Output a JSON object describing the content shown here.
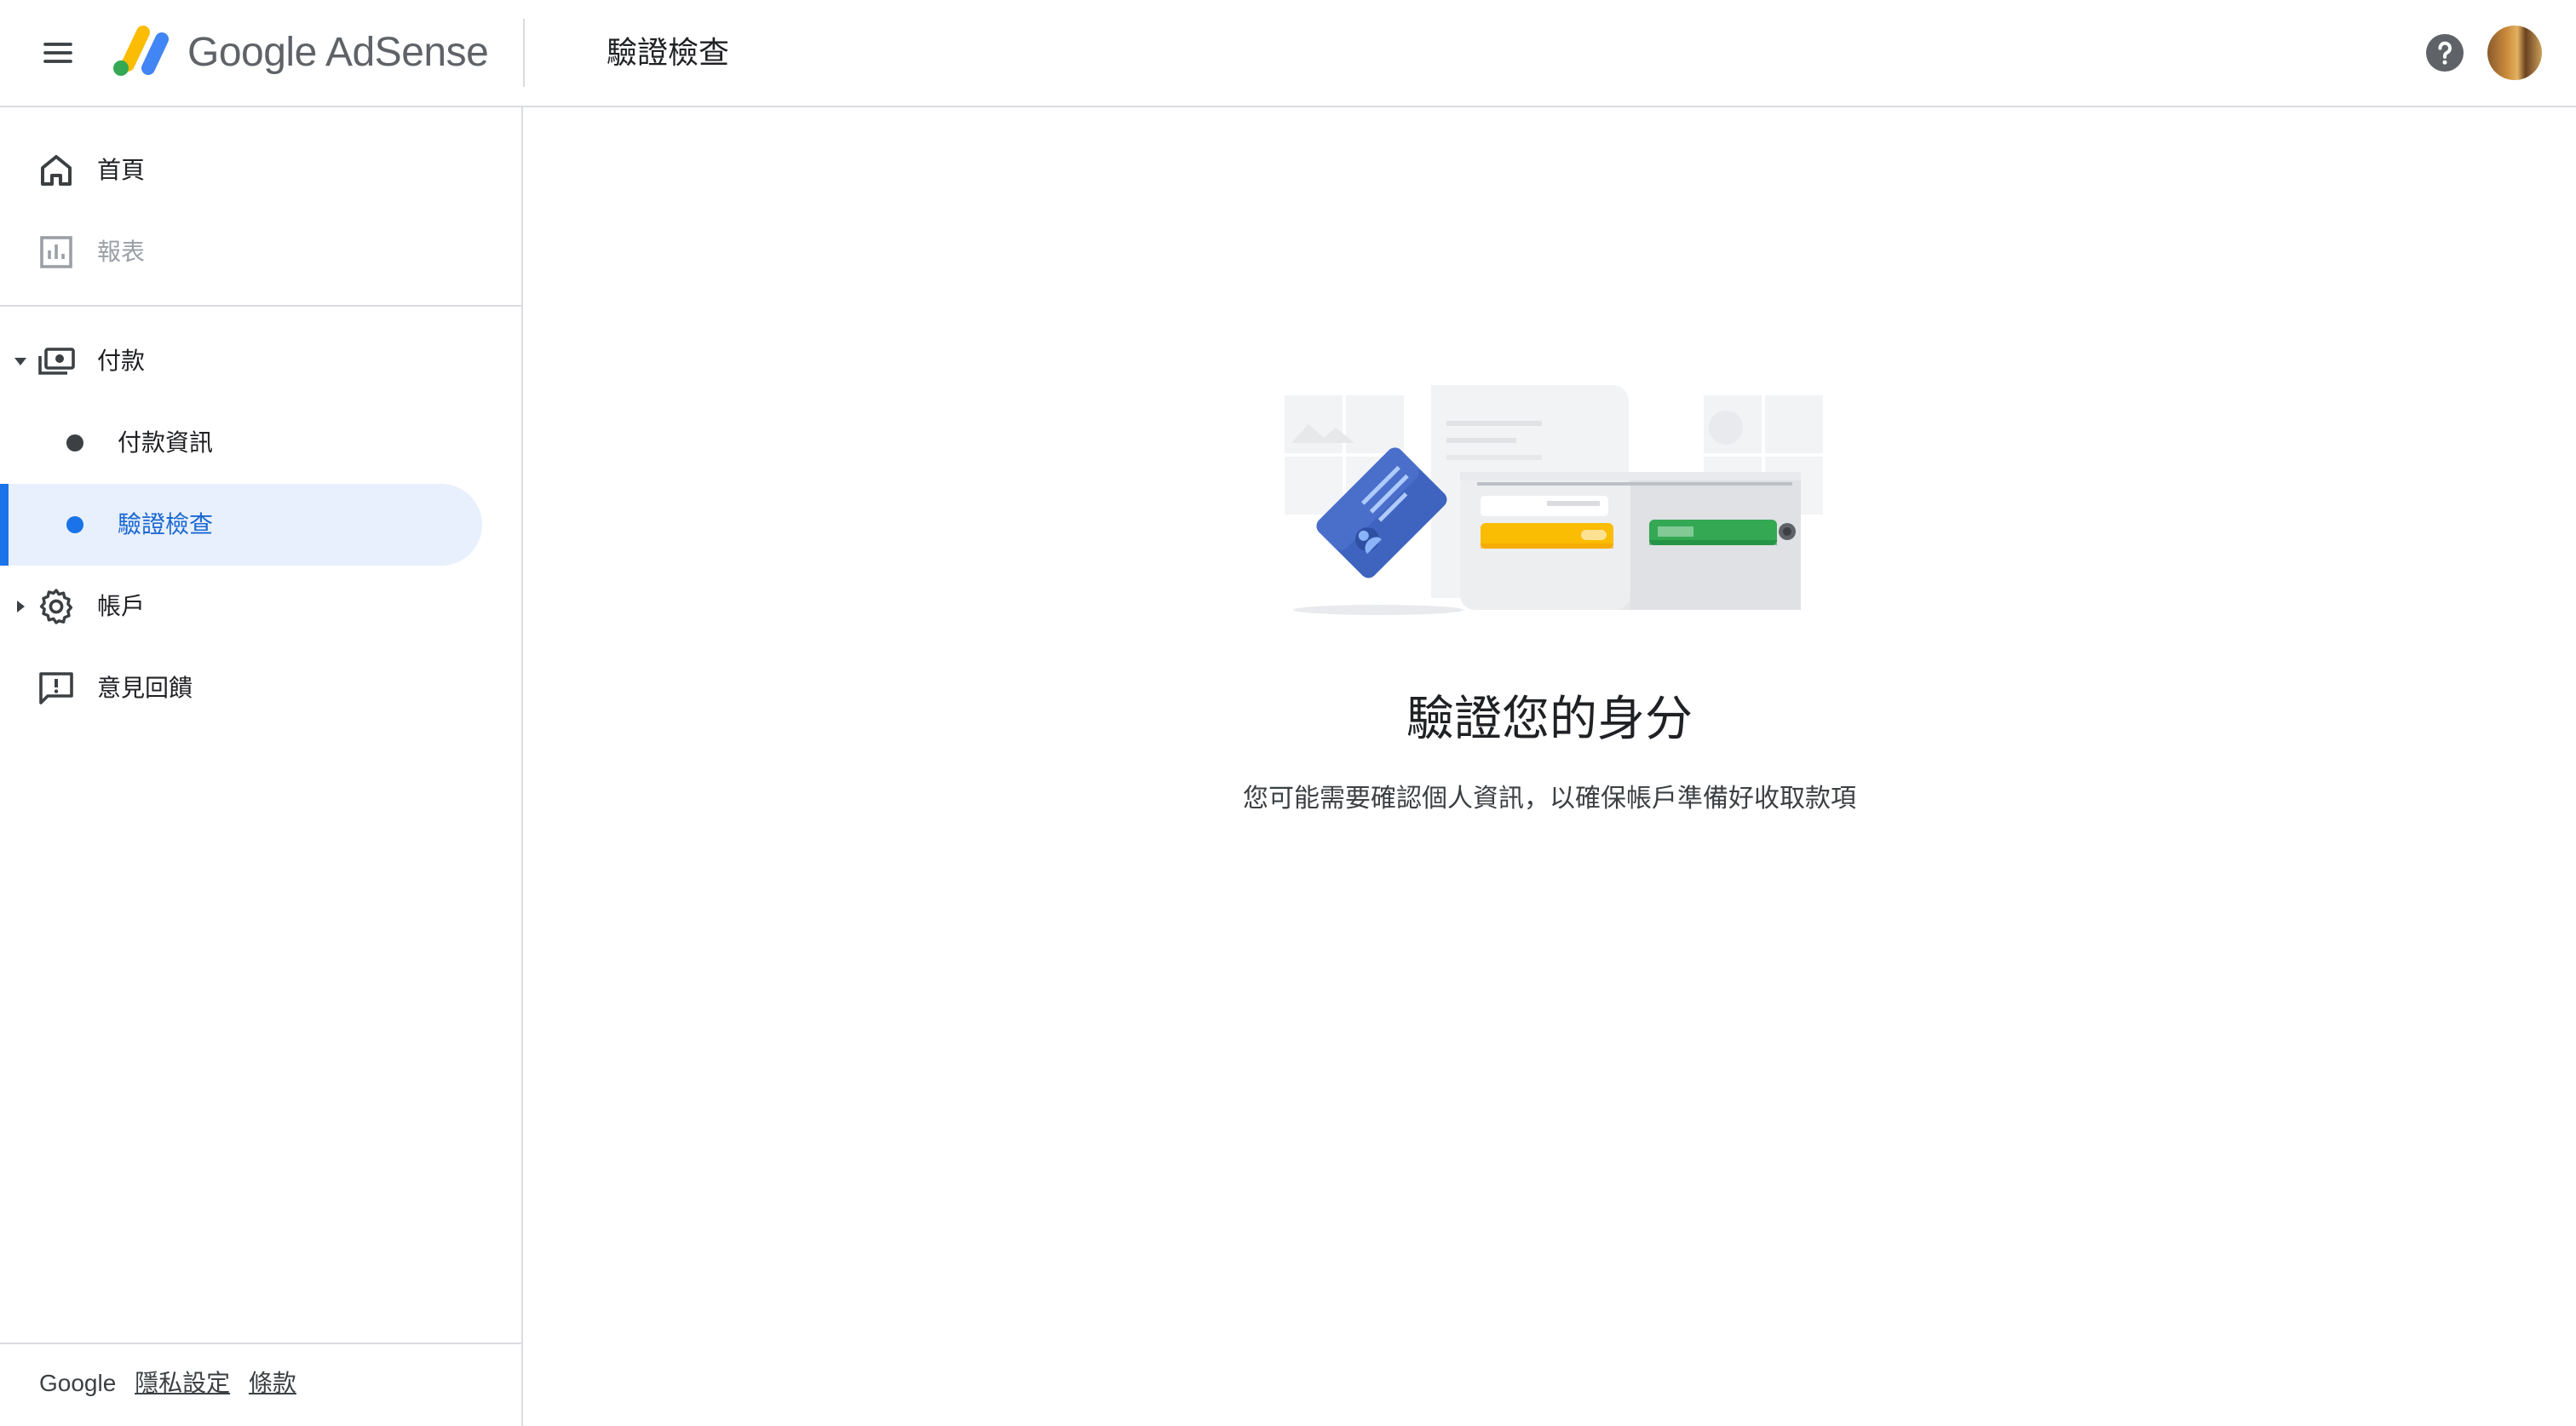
{
  "app": {
    "product_name": "Google AdSense",
    "page_title": "驗證檢查",
    "help_icon": "help-icon",
    "avatar": "user-avatar"
  },
  "sidebar": {
    "items": [
      {
        "label": "首頁",
        "icon": "home-icon",
        "disabled": false
      },
      {
        "label": "報表",
        "icon": "bar-chart-icon",
        "disabled": true
      },
      {
        "label": "付款",
        "icon": "payments-icon",
        "expanded": true,
        "children": [
          {
            "label": "付款資訊",
            "active": false
          },
          {
            "label": "驗證檢查",
            "active": true
          }
        ]
      },
      {
        "label": "帳戶",
        "icon": "gear-icon",
        "expanded": false
      },
      {
        "label": "意見回饋",
        "icon": "feedback-icon"
      }
    ],
    "footer": {
      "brand": "Google",
      "privacy_label": "隱私設定",
      "terms_label": "條款"
    }
  },
  "main": {
    "heading": "驗證您的身分",
    "description": "您可能需要確認個人資訊，以確保帳戶準備好收取款項"
  },
  "colors": {
    "accent": "#1a73e8",
    "active_bg": "#e8f0fe",
    "divider": "#dadce0"
  }
}
